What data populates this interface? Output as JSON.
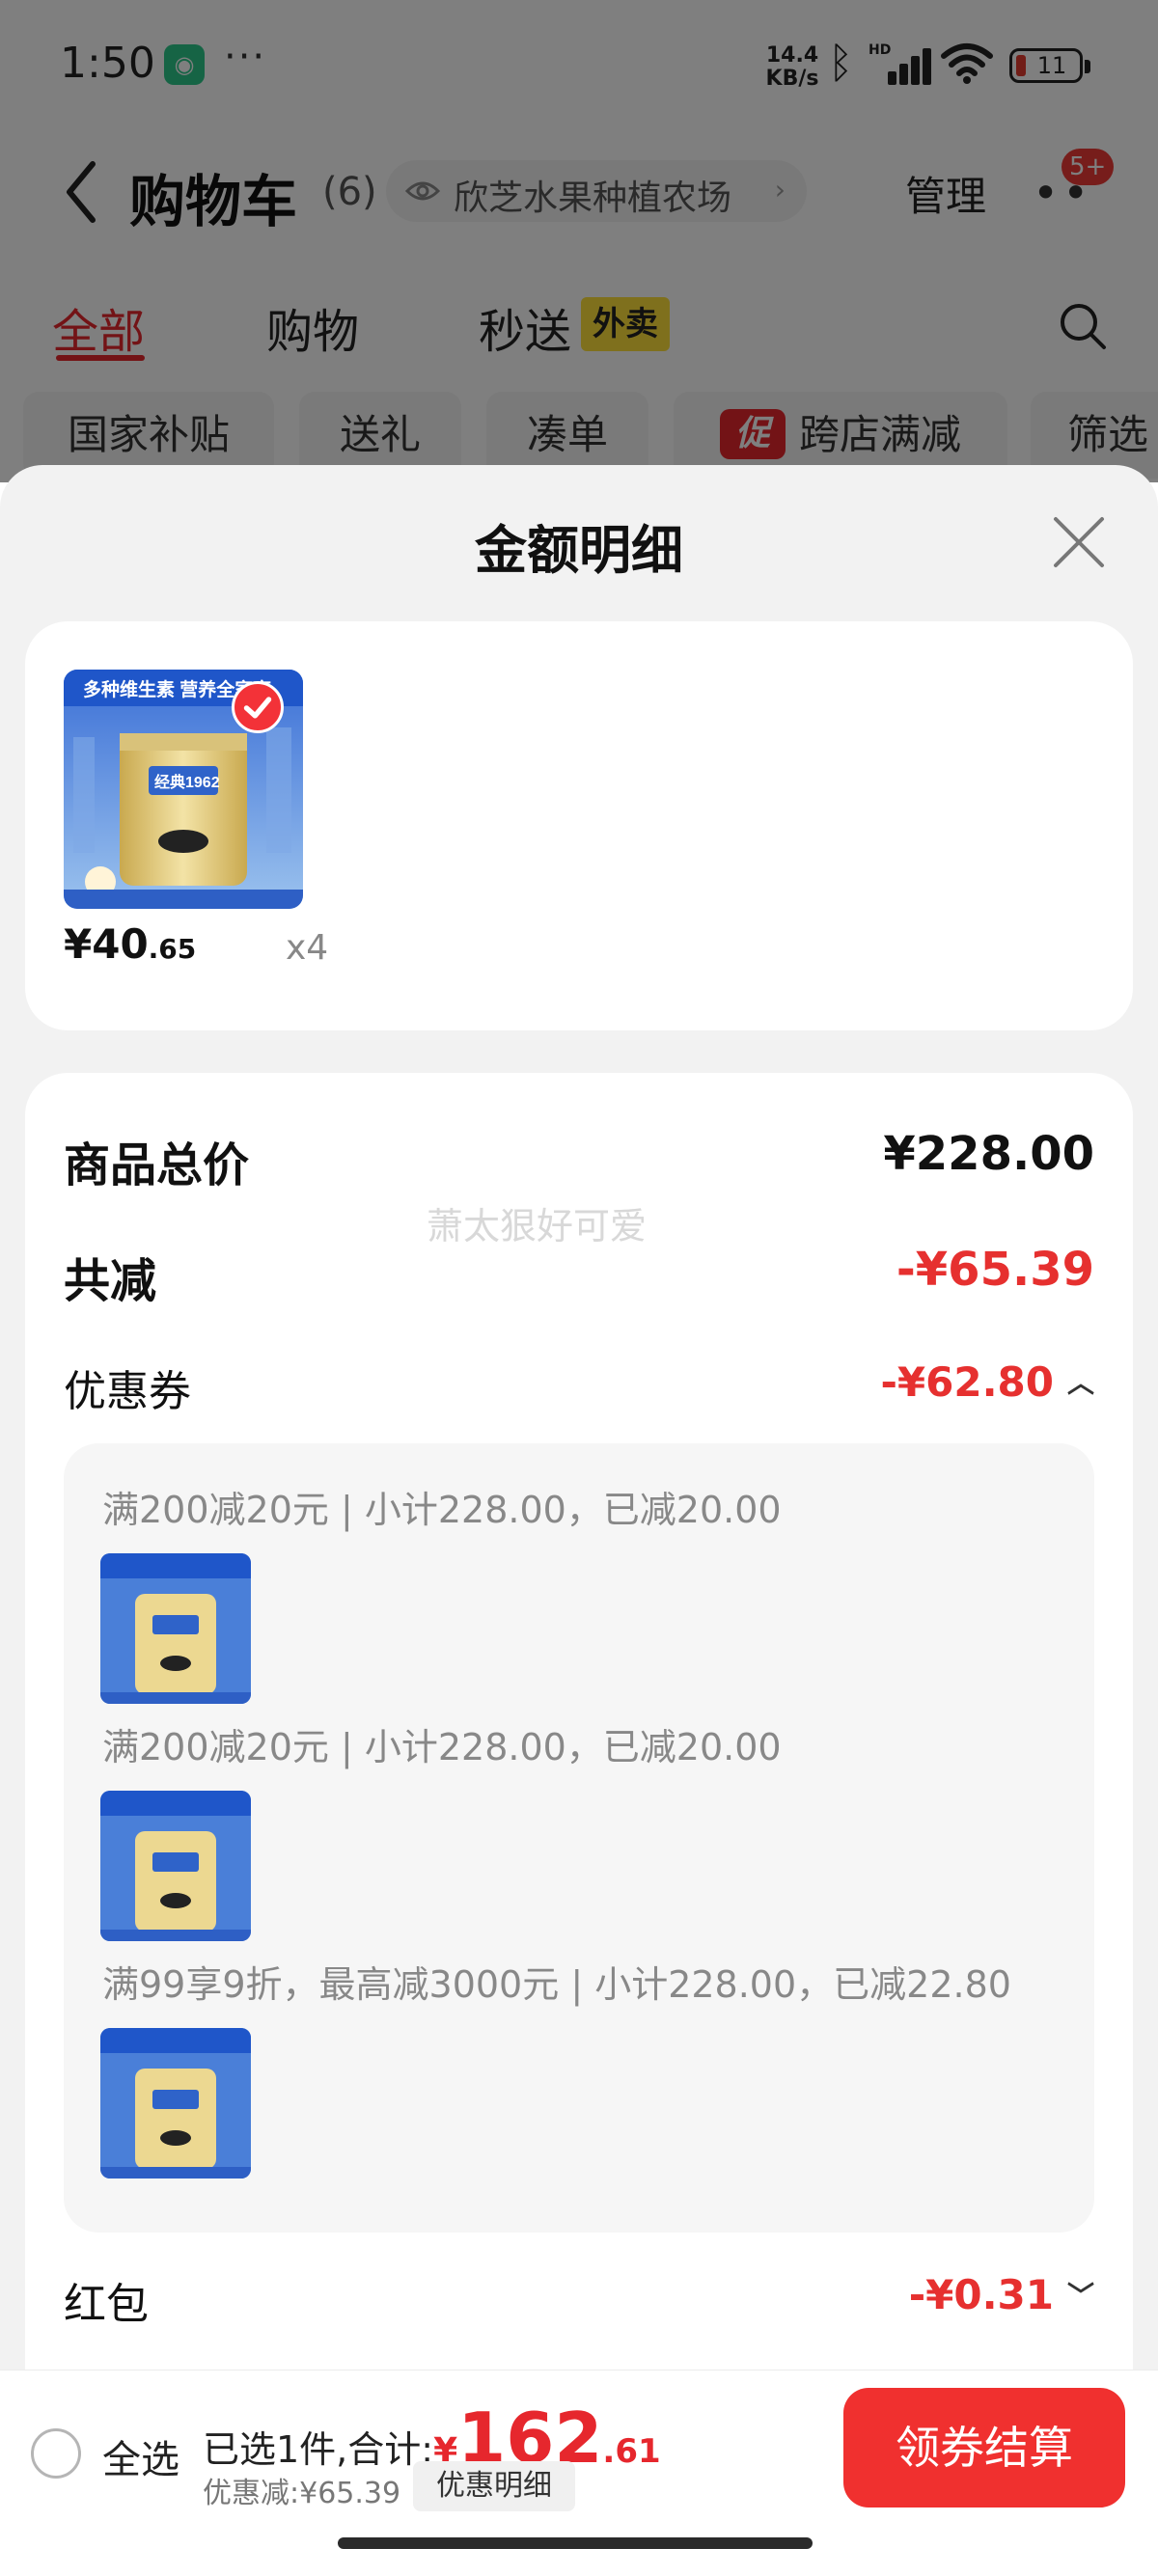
{
  "status_bar": {
    "time": "1:50",
    "app_icon": "mi-home-icon",
    "more_dots": "···",
    "net_speed_value": "14.4",
    "net_speed_unit": "KB/s",
    "bluetooth_icon": "bluetooth-icon",
    "hd_label": "HD",
    "battery_level": "11",
    "battery_color": "#e23a2e"
  },
  "nav": {
    "title": "购物车",
    "count": "(6)",
    "store_name": "欣芝水果种植农场",
    "store_chevron": "›",
    "manage_label": "管理",
    "more_dots": "••",
    "badge": "5+"
  },
  "tabs": [
    {
      "label": "全部"
    },
    {
      "label": "购物"
    },
    {
      "label": "秒送"
    }
  ],
  "tabs_extra": {
    "waimai_badge": "外卖"
  },
  "chips": [
    {
      "label": "国家补贴"
    },
    {
      "label": "送礼"
    },
    {
      "label": "凑单"
    },
    {
      "label": "跨店满减",
      "tag": "促"
    },
    {
      "label": "筛选"
    }
  ],
  "sheet": {
    "title": "金额明细",
    "product": {
      "thumb_banner": "多种维生素 营养全家享",
      "thumb_brand": "经典1962",
      "price_big": "¥40",
      "price_small": ".65",
      "qty": "x4"
    },
    "summary": {
      "total_label": "商品总价",
      "total_value": "¥228.00",
      "reduce_label": "共减",
      "reduce_value": "-¥65.39",
      "coupon_label": "优惠券",
      "coupon_value": "-¥62.80",
      "coupon_caret": "︿",
      "redpack_label": "红包",
      "redpack_value": "-¥0.31",
      "redpack_caret": "﹀",
      "watermark": "萧太狠好可爱"
    },
    "coupons": [
      {
        "text": "满200减20元 | 小计228.00，已减20.00"
      },
      {
        "text": "满200减20元 | 小计228.00，已减20.00"
      },
      {
        "text": "满99享9折，最高减3000元 | 小计228.00，已减22.80"
      }
    ]
  },
  "checkout": {
    "select_all_label": "全选",
    "selected_text": "已选1件,合计:",
    "currency": "¥",
    "total_big": "162",
    "total_small": ".61",
    "discount_text": "优惠减:¥65.39",
    "detail_button": "优惠明细",
    "checkout_button": "领券结算"
  },
  "colors": {
    "accent_red": "#e6272d",
    "checkout_button": "#f0302f",
    "waimai_yellow": "#ffe13b"
  }
}
